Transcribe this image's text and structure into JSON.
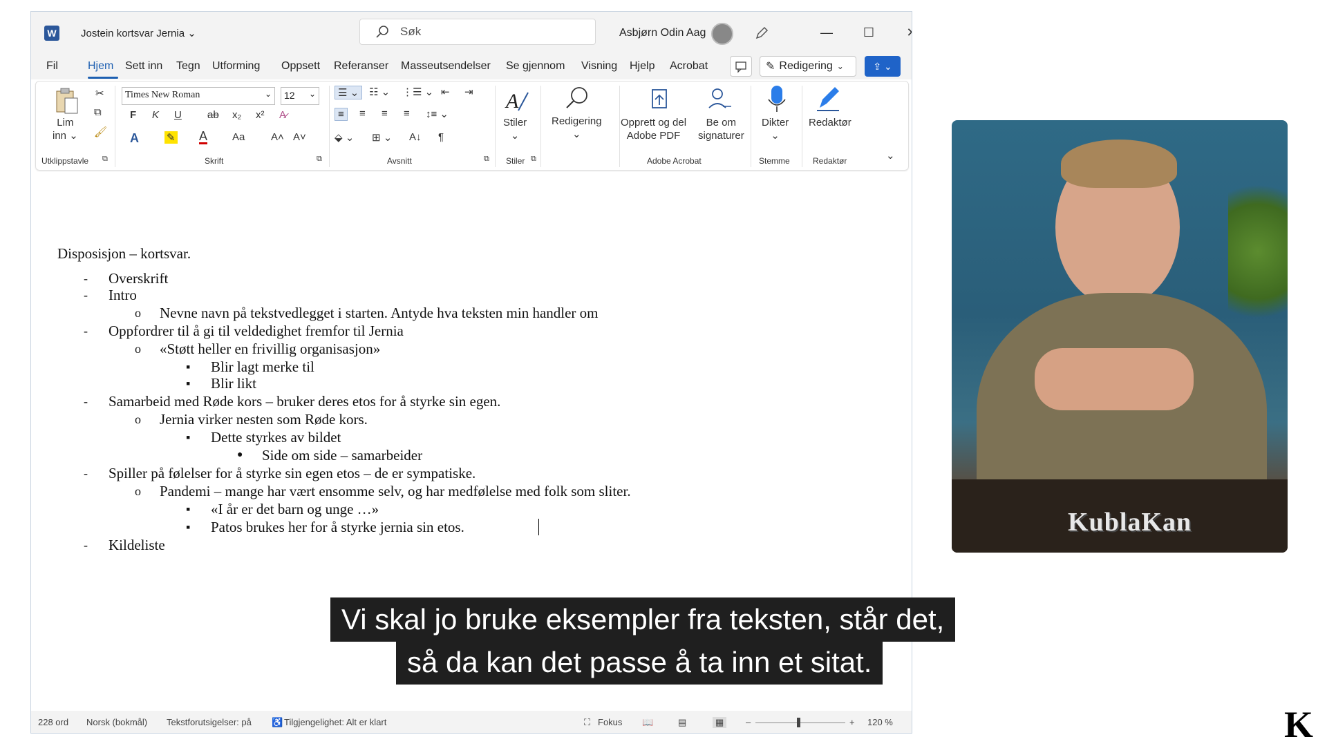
{
  "app": {
    "title": "Jostein kortsvar Jernia",
    "search_placeholder": "Søk",
    "user": "Asbjørn Odin Aag"
  },
  "menu": {
    "items": [
      "Fil",
      "Hjem",
      "Sett inn",
      "Tegn",
      "Utforming",
      "Oppsett",
      "Referanser",
      "Masseutsendelser",
      "Se gjennom",
      "Visning",
      "Hjelp",
      "Acrobat"
    ],
    "edit_mode": "Redigering"
  },
  "ribbon": {
    "font": "Times New Roman",
    "size": "12",
    "paste_label_1": "Lim",
    "paste_label_2": "inn",
    "groups": {
      "clipboard": "Utklippstavle",
      "font": "Skrift",
      "paragraph": "Avsnitt",
      "styles": "Stiler",
      "adobe": "Adobe Acrobat",
      "voice": "Stemme",
      "editor": "Redaktør"
    },
    "styles_btn": "Stiler",
    "editing_btn": "Redigering",
    "adobe_pdf_1": "Opprett og del",
    "adobe_pdf_2": "Adobe PDF",
    "adobe_sig_1": "Be om",
    "adobe_sig_2": "signaturer",
    "dictate": "Dikter",
    "editor_btn": "Redaktør",
    "fmt": {
      "bold": "F",
      "italic": "K",
      "underline": "U",
      "strike": "ab",
      "sub": "x₂",
      "sup": "x²",
      "case": "Aa",
      "grow": "A˄",
      "shrink": "A˅",
      "pilcrow": "¶"
    }
  },
  "document": {
    "heading": "Disposisjon – kortsvar.",
    "lines": [
      "Overskrift",
      "Intro",
      "Nevne navn på tekstvedlegget i starten. Antyde hva teksten min handler om",
      "Oppfordrer til å gi til veldedighet fremfor til Jernia",
      "«Støtt heller en frivillig organisasjon»",
      "Blir lagt merke til",
      "Blir likt",
      "Samarbeid med Røde kors – bruker deres etos for å styrke sin egen.",
      "Jernia virker nesten som Røde kors.",
      "Dette styrkes av bildet",
      "Side om side – samarbeider",
      "Spiller på følelser for å styrke sin egen etos – de er sympatiske.",
      "Pandemi – mange har vært ensomme selv, og har medfølelse med folk som sliter.",
      "«I år er det barn og unge …»",
      "Patos brukes her for å styrke jernia sin etos.",
      "Kildeliste"
    ],
    "markers": {
      "dash": "-",
      "circle": "o",
      "square": "▪",
      "dot": "●"
    }
  },
  "status": {
    "words": "228 ord",
    "language": "Norsk (bokmål)",
    "predictions": "Tekstforutsigelser: på",
    "accessibility": "Tilgjengelighet: Alt er klart",
    "focus": "Fokus",
    "zoom": "120 %",
    "zoom_minus": "–",
    "zoom_plus": "+"
  },
  "video": {
    "watermark": "KublaKan"
  },
  "subtitles": {
    "line1": "Vi skal jo bruke eksempler fra teksten, står det,",
    "line2": "så da kan det passe å ta inn et sitat."
  },
  "brand_mark": "K",
  "colors": {
    "accent": "#1d5fb1",
    "share": "#1f63c8",
    "word": "#2b579a"
  }
}
